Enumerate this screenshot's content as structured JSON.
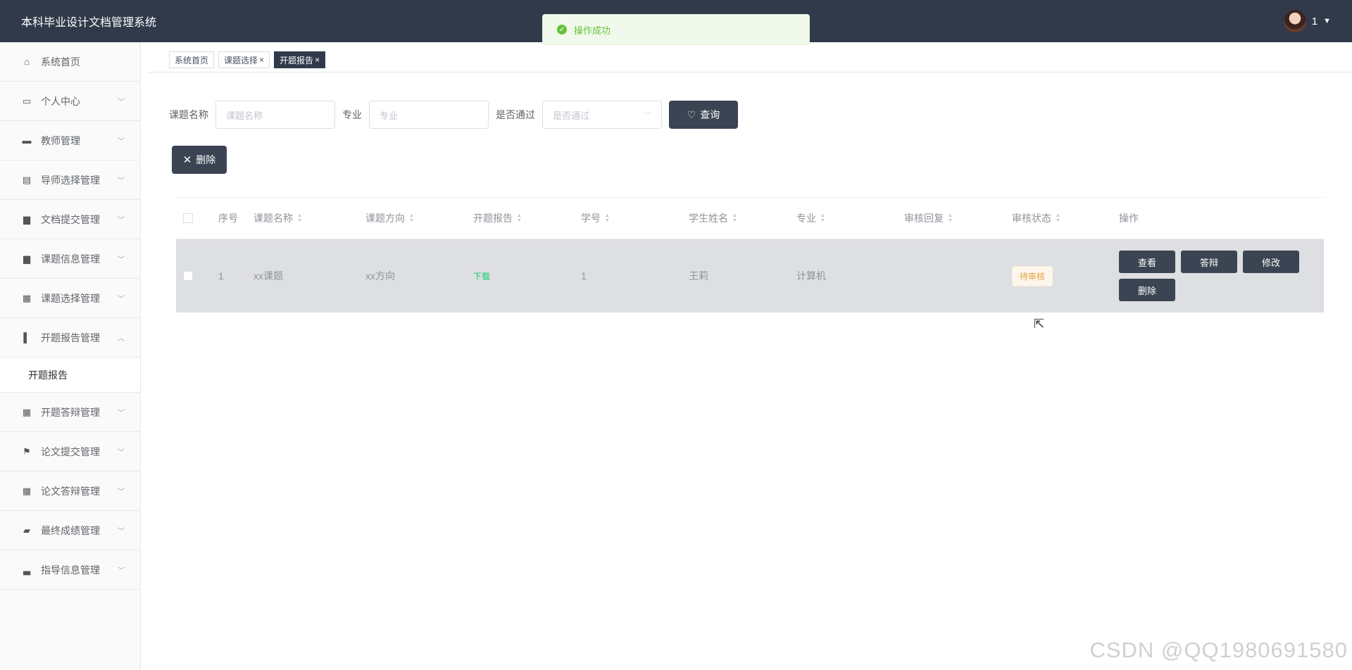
{
  "app": {
    "title": "本科毕业设计文档管理系统"
  },
  "user": {
    "name": "1"
  },
  "toast": {
    "message": "操作成功",
    "color": "#67c23a"
  },
  "sidebar": {
    "items": [
      {
        "label": "系统首页",
        "icon": "home-icon"
      },
      {
        "label": "个人中心",
        "icon": "id-card-icon"
      },
      {
        "label": "教师管理",
        "icon": "briefcase-icon"
      },
      {
        "label": "导师选择管理",
        "icon": "clipboard-icon"
      },
      {
        "label": "文档提交管理",
        "icon": "monitor-icon"
      },
      {
        "label": "课题信息管理",
        "icon": "monitor-icon"
      },
      {
        "label": "课题选择管理",
        "icon": "grid-icon"
      },
      {
        "label": "开题报告管理",
        "icon": "bar-chart-icon"
      },
      {
        "label": "开题报告"
      },
      {
        "label": "开题答辩管理",
        "icon": "grid-icon"
      },
      {
        "label": "论文提交管理",
        "icon": "flag-icon"
      },
      {
        "label": "论文答辩管理",
        "icon": "grid-icon"
      },
      {
        "label": "最终成绩管理",
        "icon": "trend-icon"
      },
      {
        "label": "指导信息管理",
        "icon": "desktop-icon"
      }
    ]
  },
  "tabs": [
    {
      "label": "系统首页"
    },
    {
      "label": "课题选择",
      "close": "×"
    },
    {
      "label": "开题报告",
      "close": "×"
    }
  ],
  "search": {
    "topic_label": "课题名称",
    "topic_placeholder": "课题名称",
    "major_label": "专业",
    "major_placeholder": "专业",
    "passed_label": "是否通过",
    "passed_placeholder": "是否通过",
    "query_button": "查询"
  },
  "actions": {
    "delete_button": "删除"
  },
  "table": {
    "headers": [
      "序号",
      "课题名称",
      "课题方向",
      "开题报告",
      "学号",
      "学生姓名",
      "专业",
      "审核回复",
      "审核状态",
      "操作"
    ],
    "rows": [
      {
        "index": "1",
        "topic": "xx课题",
        "direction": "xx方向",
        "report": "下载",
        "student_id": "1",
        "student_name": "王莉",
        "major": "计算机",
        "reply": "",
        "status": "待审核",
        "ops": [
          "查看",
          "答辩",
          "修改",
          "删除"
        ]
      }
    ]
  },
  "watermark": "CSDN @QQ1980691580",
  "colors": {
    "topbar": "#303a4a",
    "button": "#3b4452",
    "success": "#67c23a",
    "pending": "#e6a23c",
    "link": "#13ce66"
  }
}
